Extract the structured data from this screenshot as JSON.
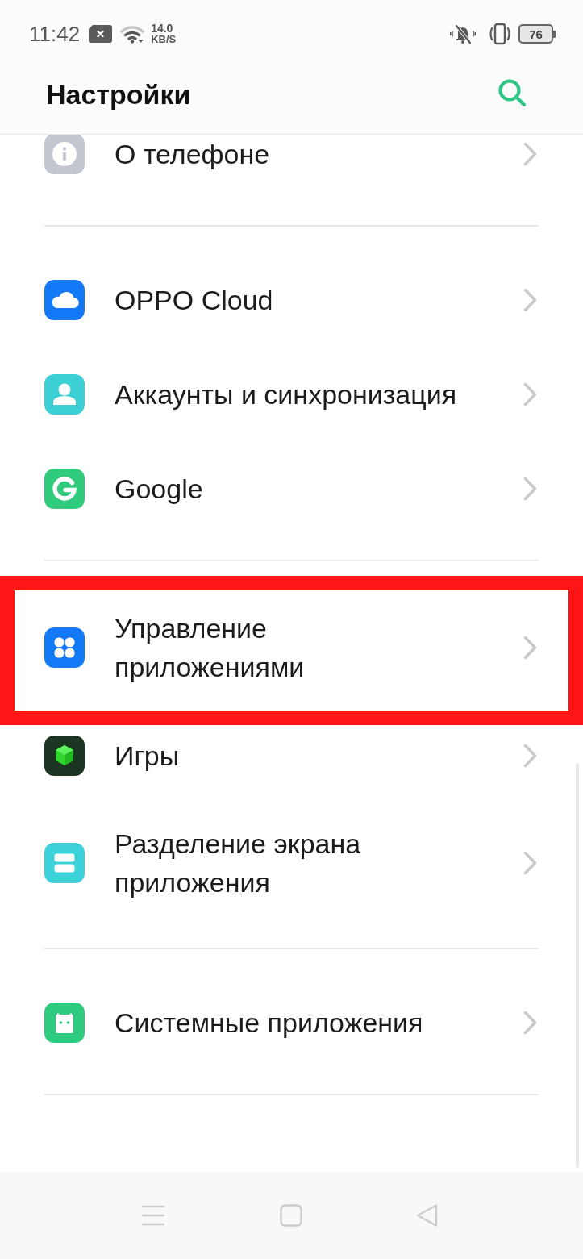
{
  "status_bar": {
    "time": "11:42",
    "speed_value": "14.0",
    "speed_unit": "KB/S",
    "battery": "76"
  },
  "header": {
    "title": "Настройки"
  },
  "sections": [
    {
      "items": [
        {
          "kind": "info",
          "label": "О телефоне",
          "highlighted": false
        }
      ]
    },
    {
      "items": [
        {
          "kind": "cloud",
          "label": "OPPO Cloud",
          "highlighted": false
        },
        {
          "kind": "accounts",
          "label": "Аккаунты и синхронизация",
          "highlighted": false
        },
        {
          "kind": "google",
          "label": "Google",
          "highlighted": false
        }
      ]
    },
    {
      "items": [
        {
          "kind": "apps",
          "label": "Управление\nприложениями",
          "highlighted": true
        },
        {
          "kind": "games",
          "label": "Игры",
          "highlighted": false
        },
        {
          "kind": "split",
          "label": "Разделение экрана\nприложения",
          "highlighted": false
        }
      ]
    },
    {
      "items": [
        {
          "kind": "system",
          "label": "Системные приложения",
          "highlighted": false
        }
      ]
    }
  ]
}
